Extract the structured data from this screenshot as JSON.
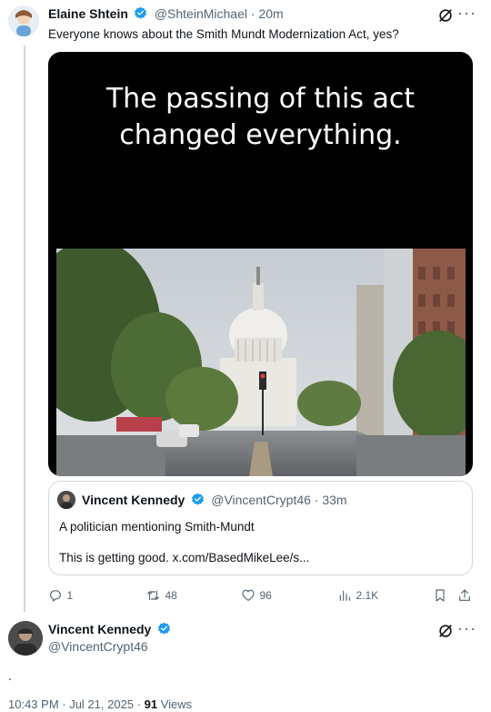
{
  "tweet": {
    "author_name": "Elaine Shtein",
    "handle_time": "@ShteinMichael · 20m",
    "text": "Everyone knows about the Smith Mundt Modernization Act, yes?",
    "media_caption_line1": "The passing of this act",
    "media_caption_line2": "changed everything.",
    "quote": {
      "author_name": "Vincent Kennedy",
      "handle_time": "@VincentCrypt46 · 33m",
      "line1": "A politician mentioning Smith-Mundt",
      "line2": "This is getting good. x.com/BasedMikeLee/s..."
    },
    "actions": {
      "replies": "1",
      "reposts": "48",
      "likes": "96",
      "views": "2.1K"
    }
  },
  "reply": {
    "author_name": "Vincent Kennedy",
    "handle": "@VincentCrypt46",
    "text": ".",
    "timestamp": "10:43 PM · Jul 21, 2025 · ",
    "views_count": "91",
    "views_label": " Views"
  },
  "colors": {
    "verified": "#1d9bf0",
    "muted": "#536471",
    "border": "#cfd9de"
  }
}
